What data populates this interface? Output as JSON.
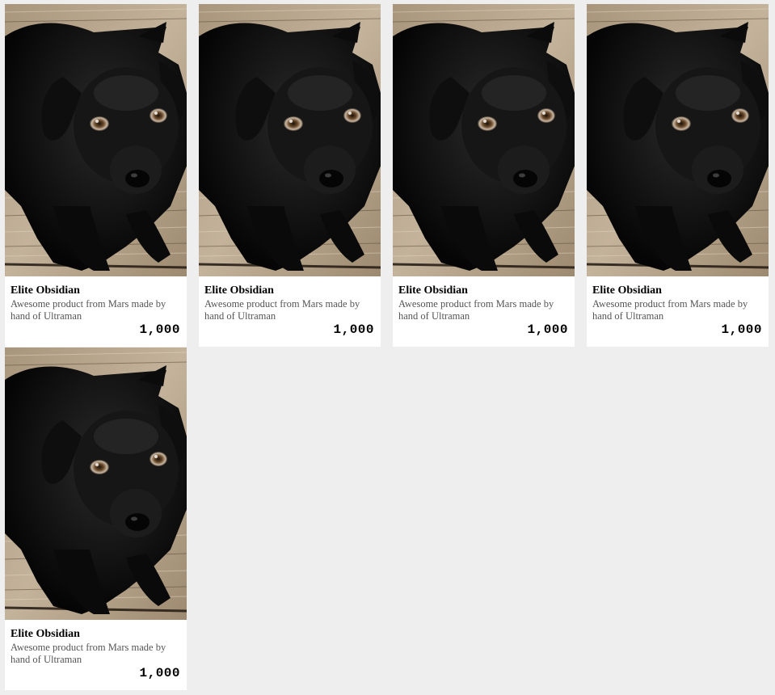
{
  "products": [
    {
      "name": "Elite Obsidian",
      "description": "Awesome product from Mars made by hand of Ultraman",
      "price": "1,000",
      "image_icon": "black-puppy-photo"
    },
    {
      "name": "Elite Obsidian",
      "description": "Awesome product from Mars made by hand of Ultraman",
      "price": "1,000",
      "image_icon": "black-puppy-photo"
    },
    {
      "name": "Elite Obsidian",
      "description": "Awesome product from Mars made by hand of Ultraman",
      "price": "1,000",
      "image_icon": "black-puppy-photo"
    },
    {
      "name": "Elite Obsidian",
      "description": "Awesome product from Mars made by hand of Ultraman",
      "price": "1,000",
      "image_icon": "black-puppy-photo"
    },
    {
      "name": "Elite Obsidian",
      "description": "Awesome product from Mars made by hand of Ultraman",
      "price": "1,000",
      "image_icon": "black-puppy-photo"
    }
  ],
  "colors": {
    "page_background": "#eeeeee",
    "card_background": "#ffffff",
    "floor_wood": "#b9a68c",
    "puppy_fur": "#111111"
  }
}
